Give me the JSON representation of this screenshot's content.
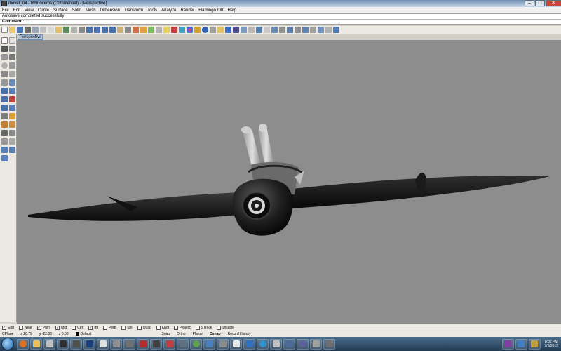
{
  "window": {
    "title": "mover_04 - Rhinoceros (Commercial) - [Perspective]",
    "buttons": {
      "minimize": "–",
      "maximize": "□",
      "close": "✕"
    }
  },
  "menu": {
    "items": [
      "File",
      "Edit",
      "View",
      "Curve",
      "Surface",
      "Solid",
      "Mesh",
      "Dimension",
      "Transform",
      "Tools",
      "Analyze",
      "Render",
      "Flamingo nXt",
      "Help"
    ]
  },
  "command": {
    "history": "Autosave completed successfully",
    "prompt_label": "Command:",
    "value": ""
  },
  "viewport": {
    "tab_label": "Perspective",
    "background": "#8d8d8d"
  },
  "osnap": {
    "items": [
      {
        "label": "End",
        "checked": true
      },
      {
        "label": "Near",
        "checked": false
      },
      {
        "label": "Point",
        "checked": true
      },
      {
        "label": "Mid",
        "checked": true
      },
      {
        "label": "Cen",
        "checked": false
      },
      {
        "label": "Int",
        "checked": true
      },
      {
        "label": "Perp",
        "checked": false
      },
      {
        "label": "Tan",
        "checked": false
      },
      {
        "label": "Quad",
        "checked": false
      },
      {
        "label": "Knot",
        "checked": false
      },
      {
        "label": "Project",
        "checked": false
      },
      {
        "label": "STrack",
        "checked": false
      },
      {
        "label": "Disable",
        "checked": false
      }
    ]
  },
  "status": {
    "cplane": "CPlane",
    "x": "x 28.79",
    "y": "y -22.86",
    "z": "z 0.00",
    "layer": "Default",
    "snap": "Snap",
    "ortho": "Ortho",
    "planar": "Planar",
    "osnap": "Osnap",
    "record_history": "Record History"
  },
  "taskbar": {
    "time": "8:32 PM",
    "date": "7/6/2012"
  },
  "colors": {
    "title_gradient_top": "#6f8fb3",
    "viewport_bg": "#8d8d8d",
    "taskbar": "#2f4d6a",
    "close_button": "#c6463a"
  }
}
